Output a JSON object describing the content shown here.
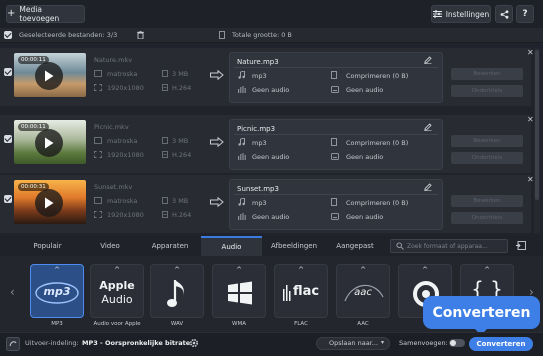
{
  "toolbar": {
    "add_label": "Media toevoegen",
    "settings_label": "Instellingen",
    "help_label": "?"
  },
  "selection": {
    "selected_label": "Geselecteerde bestanden: 3/3",
    "total_label": "Totale grootte: 0 B"
  },
  "files": [
    {
      "name": "Nature.mkv",
      "time": "00:00:11",
      "container": "matroska",
      "size": "3 MB",
      "resolution": "1920x1080",
      "codec": "H.264",
      "output_name": "Nature.mp3",
      "format": "mp3",
      "compress": "Comprimeren (0 B)",
      "audio1": "Geen audio",
      "audio2": "Geen audio",
      "edit_label": "Bewerken",
      "subs_label": "Ondertitels"
    },
    {
      "name": "Picnic.mkv",
      "time": "00:00:11",
      "container": "matroska",
      "size": "3 MB",
      "resolution": "1920x1080",
      "codec": "H.264",
      "output_name": "Picnic.mp3",
      "format": "mp3",
      "compress": "Comprimeren (0 B)",
      "audio1": "Geen audio",
      "audio2": "Geen audio",
      "edit_label": "Bewerken",
      "subs_label": "Ondertitels"
    },
    {
      "name": "Sunset.mkv",
      "time": "00:00:31",
      "container": "matroska",
      "size": "3 MB",
      "resolution": "1920x1080",
      "codec": "H.264",
      "output_name": "Sunset.mp3",
      "format": "mp3",
      "compress": "Comprimeren (0 B)",
      "audio1": "Geen audio",
      "audio2": "Geen audio",
      "edit_label": "Bewerken",
      "subs_label": "Ondertitels"
    }
  ],
  "tabs": [
    "Populair",
    "Video",
    "Apparaten",
    "Audio",
    "Afbeeldingen",
    "Aangepast"
  ],
  "active_tab": "Audio",
  "search": {
    "placeholder": "Zoek formaat of apparaa..."
  },
  "formats": [
    {
      "label": "MP3",
      "icon_text": "mp3"
    },
    {
      "label": "Audio voor Apple",
      "icon_text_top": "Apple",
      "icon_text_bottom": "Audio"
    },
    {
      "label": "WAV"
    },
    {
      "label": "WMA"
    },
    {
      "label": "FLAC",
      "icon_text": "flac"
    },
    {
      "label": "AAC",
      "icon_text": "aac"
    },
    {
      "label": ""
    },
    {
      "label": ""
    }
  ],
  "bottom": {
    "output_label": "Uitvoer-indeling:",
    "output_value": "MP3 - Oorspronkelijke bitrate",
    "save_label": "Opslaan naar...",
    "merge_label": "Samenvoegen:",
    "convert_label": "Converteren"
  },
  "tooltip": {
    "label": "Converteren"
  },
  "colors": {
    "accent": "#3d7fe6",
    "background": "#20232b"
  }
}
